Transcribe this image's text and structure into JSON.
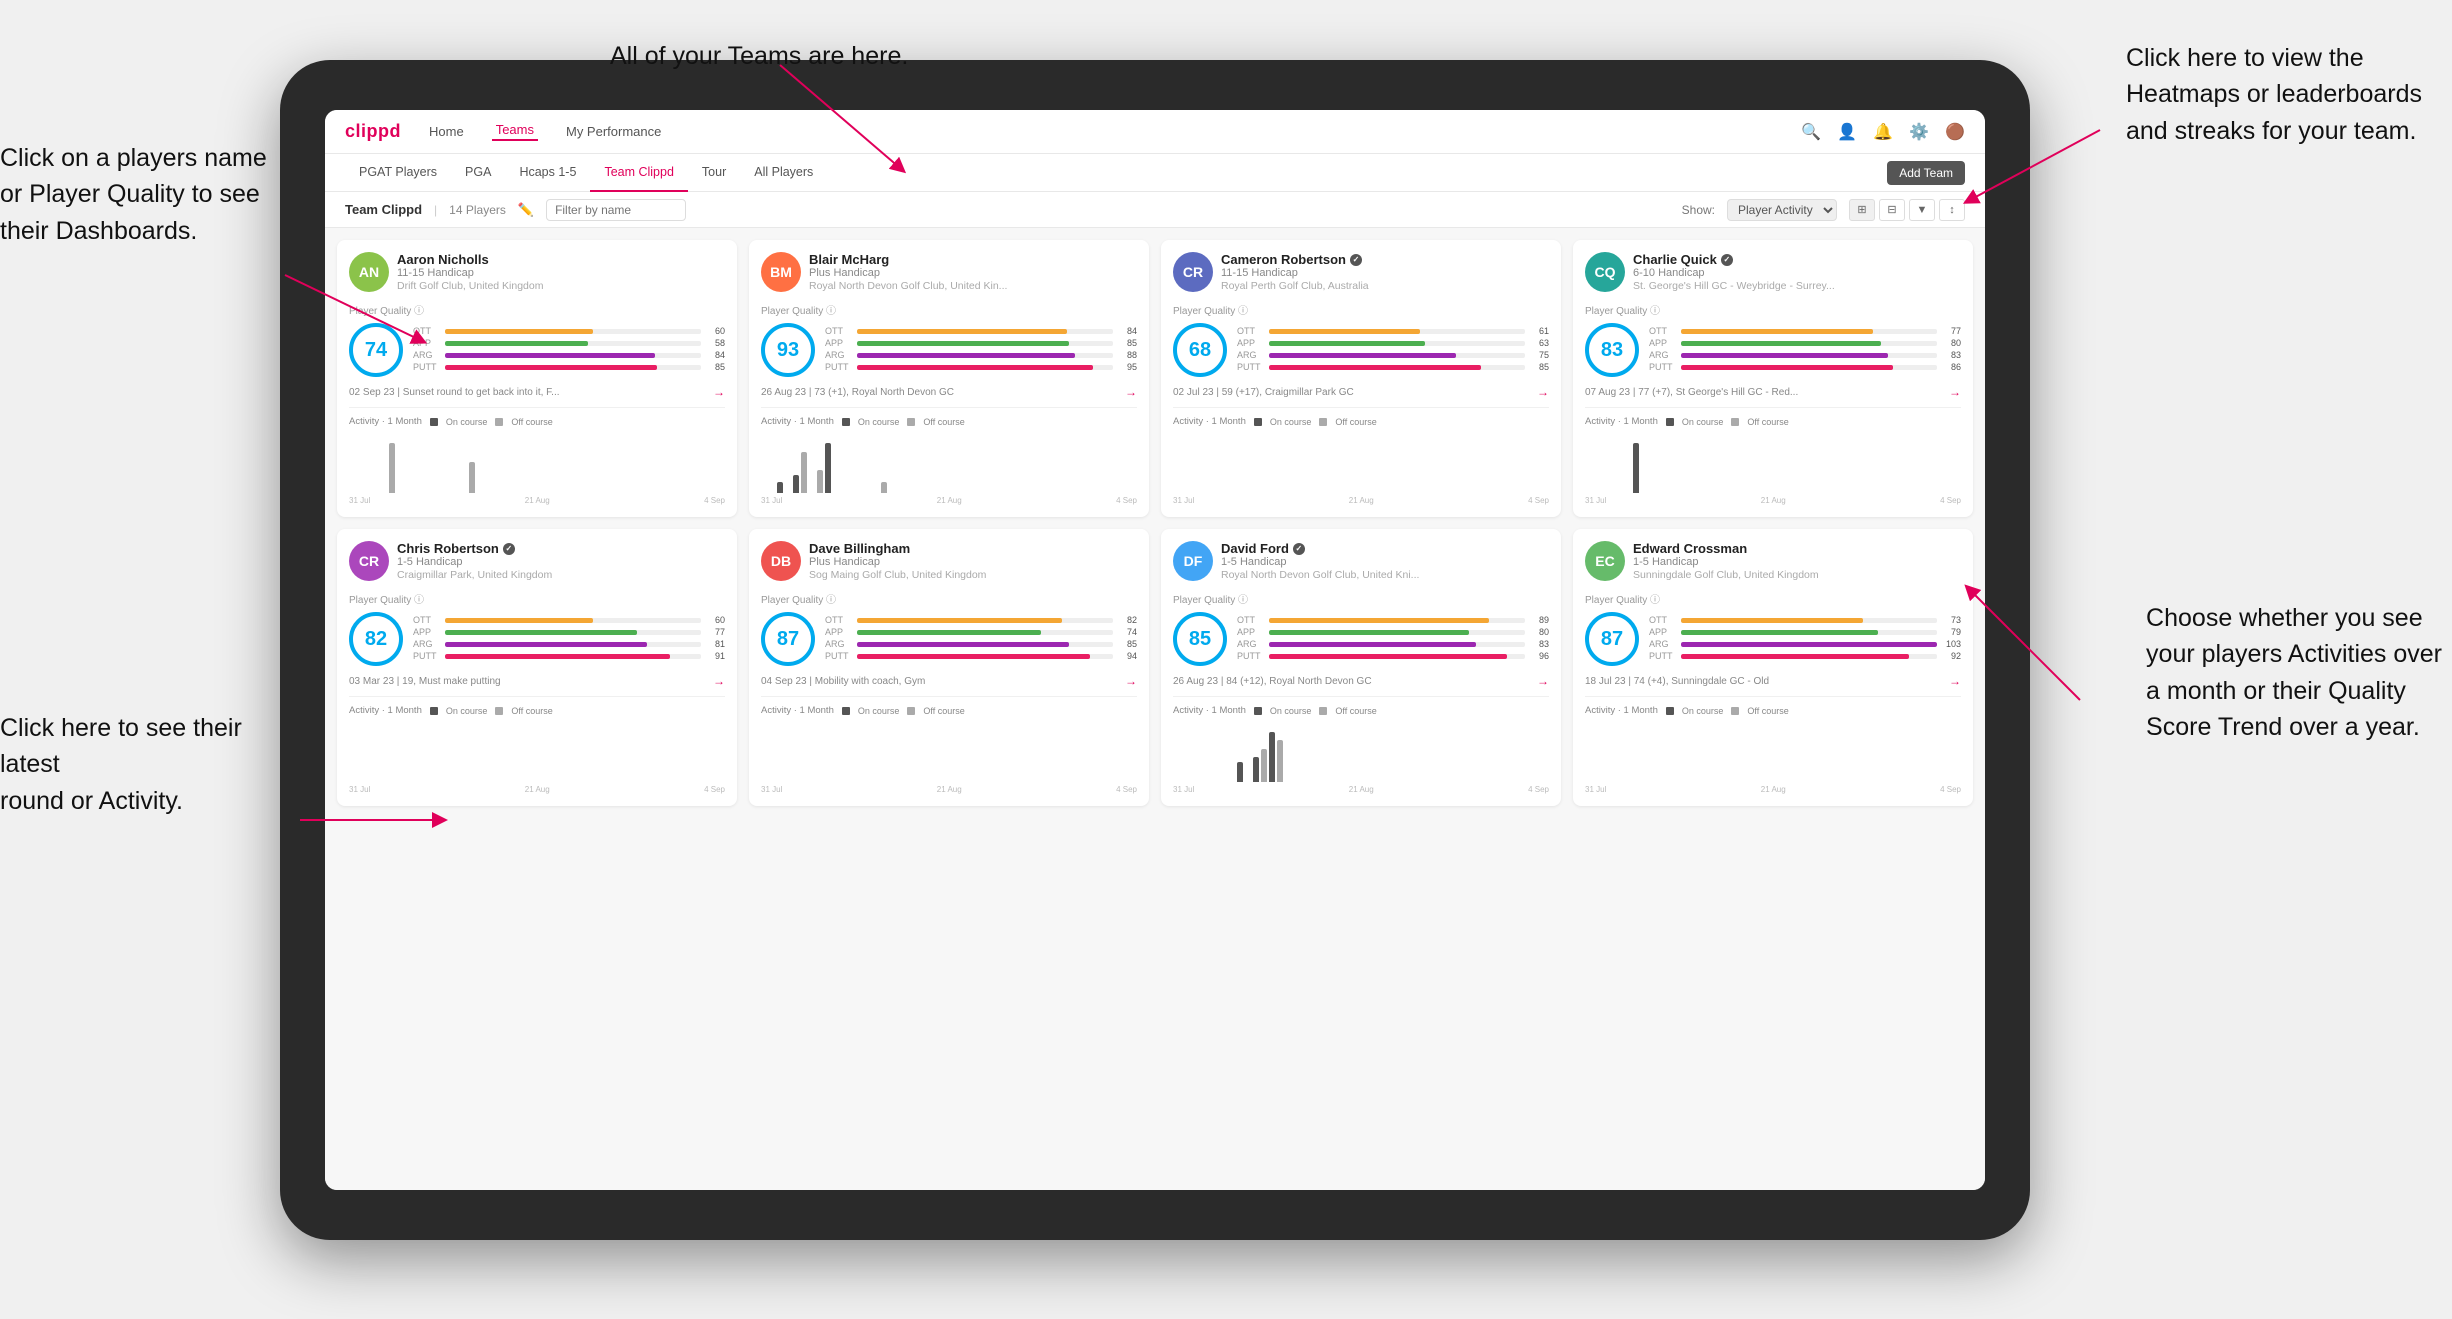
{
  "annotations": {
    "top_teams": "All of your Teams are here.",
    "top_right_heatmaps": "Click here to view the\nHeatmaps or leaderboards\nand streaks for your team.",
    "left_names": "Click on a players name\nor Player Quality to see\ntheir Dashboards.",
    "left_rounds": "Click here to see their latest\nround or Activity.",
    "right_activities": "Choose whether you see\nyour players Activities over\na month or their Quality\nScore Trend over a year."
  },
  "navbar": {
    "logo": "clippd",
    "links": [
      "Home",
      "Teams",
      "My Performance"
    ],
    "active": "Teams"
  },
  "subtabs": {
    "tabs": [
      "PGAT Players",
      "PGA",
      "Hcaps 1-5",
      "Team Clippd",
      "Tour",
      "All Players"
    ],
    "active": "Team Clippd",
    "add_button": "Add Team"
  },
  "team_header": {
    "title": "Team Clippd",
    "separator": "|",
    "player_count": "14 Players",
    "filter_placeholder": "Filter by name",
    "show_label": "Show:",
    "show_option": "Player Activity",
    "view_modes": [
      "grid4",
      "grid3",
      "filter",
      "sort"
    ]
  },
  "players": [
    {
      "name": "Aaron Nicholls",
      "handicap": "11-15 Handicap",
      "club": "Drift Golf Club, United Kingdom",
      "score": 74,
      "score_color": "#00aaee",
      "avatar_color": "#8bc34a",
      "avatar_initials": "AN",
      "stats": [
        {
          "label": "OTT",
          "value": 60,
          "color": "#f4a634"
        },
        {
          "label": "APP",
          "value": 58,
          "color": "#4caf50"
        },
        {
          "label": "ARG",
          "value": 84,
          "color": "#9c27b0"
        },
        {
          "label": "PUTT",
          "value": 85,
          "color": "#e91e63"
        }
      ],
      "latest_round": "02 Sep 23 | Sunset round to get back into it, F...",
      "chart_bars": [
        0,
        0,
        0,
        0,
        0,
        8,
        0,
        0,
        0,
        0,
        0,
        0,
        0,
        0,
        0,
        5,
        0
      ],
      "chart_labels": [
        "31 Jul",
        "21 Aug",
        "4 Sep"
      ],
      "verified": false
    },
    {
      "name": "Blair McHarg",
      "handicap": "Plus Handicap",
      "club": "Royal North Devon Golf Club, United Kin...",
      "score": 93,
      "score_color": "#00aaee",
      "avatar_color": "#ff7043",
      "avatar_initials": "BM",
      "stats": [
        {
          "label": "OTT",
          "value": 84,
          "color": "#f4a634"
        },
        {
          "label": "APP",
          "value": 85,
          "color": "#4caf50"
        },
        {
          "label": "ARG",
          "value": 88,
          "color": "#9c27b0"
        },
        {
          "label": "PUTT",
          "value": 95,
          "color": "#e91e63"
        }
      ],
      "latest_round": "26 Aug 23 | 73 (+1), Royal North Devon GC",
      "chart_bars": [
        0,
        0,
        5,
        0,
        8,
        18,
        0,
        10,
        22,
        0,
        0,
        0,
        0,
        0,
        0,
        5,
        0
      ],
      "chart_labels": [
        "31 Jul",
        "21 Aug",
        "4 Sep"
      ],
      "verified": false
    },
    {
      "name": "Cameron Robertson",
      "handicap": "11-15 Handicap",
      "club": "Royal Perth Golf Club, Australia",
      "score": 68,
      "score_color": "#00aaee",
      "avatar_color": "#5c6bc0",
      "avatar_initials": "CR",
      "stats": [
        {
          "label": "OTT",
          "value": 61,
          "color": "#f4a634"
        },
        {
          "label": "APP",
          "value": 63,
          "color": "#4caf50"
        },
        {
          "label": "ARG",
          "value": 75,
          "color": "#9c27b0"
        },
        {
          "label": "PUTT",
          "value": 85,
          "color": "#e91e63"
        }
      ],
      "latest_round": "02 Jul 23 | 59 (+17), Craigmillar Park GC",
      "chart_bars": [
        0,
        0,
        0,
        0,
        0,
        0,
        0,
        0,
        0,
        0,
        0,
        0,
        0,
        0,
        0,
        0,
        0
      ],
      "chart_labels": [
        "31 Jul",
        "21 Aug",
        "4 Sep"
      ],
      "verified": true
    },
    {
      "name": "Charlie Quick",
      "handicap": "6-10 Handicap",
      "club": "St. George's Hill GC - Weybridge - Surrey...",
      "score": 83,
      "score_color": "#00aaee",
      "avatar_color": "#26a69a",
      "avatar_initials": "CQ",
      "stats": [
        {
          "label": "OTT",
          "value": 77,
          "color": "#f4a634"
        },
        {
          "label": "APP",
          "value": 80,
          "color": "#4caf50"
        },
        {
          "label": "ARG",
          "value": 83,
          "color": "#9c27b0"
        },
        {
          "label": "PUTT",
          "value": 86,
          "color": "#e91e63"
        }
      ],
      "latest_round": "07 Aug 23 | 77 (+7), St George's Hill GC - Red...",
      "chart_bars": [
        0,
        0,
        0,
        0,
        0,
        0,
        10,
        0,
        0,
        0,
        0,
        0,
        0,
        0,
        0,
        0,
        0
      ],
      "chart_labels": [
        "31 Jul",
        "21 Aug",
        "4 Sep"
      ],
      "verified": true
    },
    {
      "name": "Chris Robertson",
      "handicap": "1-5 Handicap",
      "club": "Craigmillar Park, United Kingdom",
      "score": 82,
      "score_color": "#00aaee",
      "avatar_color": "#ab47bc",
      "avatar_initials": "CR",
      "stats": [
        {
          "label": "OTT",
          "value": 60,
          "color": "#f4a634"
        },
        {
          "label": "APP",
          "value": 77,
          "color": "#4caf50"
        },
        {
          "label": "ARG",
          "value": 81,
          "color": "#9c27b0"
        },
        {
          "label": "PUTT",
          "value": 91,
          "color": "#e91e63"
        }
      ],
      "latest_round": "03 Mar 23 | 19, Must make putting",
      "chart_bars": [
        0,
        0,
        0,
        0,
        0,
        0,
        0,
        0,
        0,
        0,
        0,
        0,
        0,
        0,
        0,
        0,
        0
      ],
      "chart_labels": [
        "31 Jul",
        "21 Aug",
        "4 Sep"
      ],
      "verified": true
    },
    {
      "name": "Dave Billingham",
      "handicap": "Plus Handicap",
      "club": "Sog Maing Golf Club, United Kingdom",
      "score": 87,
      "score_color": "#00aaee",
      "avatar_color": "#ef5350",
      "avatar_initials": "DB",
      "stats": [
        {
          "label": "OTT",
          "value": 82,
          "color": "#f4a634"
        },
        {
          "label": "APP",
          "value": 74,
          "color": "#4caf50"
        },
        {
          "label": "ARG",
          "value": 85,
          "color": "#9c27b0"
        },
        {
          "label": "PUTT",
          "value": 94,
          "color": "#e91e63"
        }
      ],
      "latest_round": "04 Sep 23 | Mobility with coach, Gym",
      "chart_bars": [
        0,
        0,
        0,
        0,
        0,
        0,
        0,
        0,
        0,
        0,
        0,
        0,
        0,
        0,
        0,
        0,
        0
      ],
      "chart_labels": [
        "31 Jul",
        "21 Aug",
        "4 Sep"
      ],
      "verified": false
    },
    {
      "name": "David Ford",
      "handicap": "1-5 Handicap",
      "club": "Royal North Devon Golf Club, United Kni...",
      "score": 85,
      "score_color": "#00aaee",
      "avatar_color": "#42a5f5",
      "avatar_initials": "DF",
      "stats": [
        {
          "label": "OTT",
          "value": 89,
          "color": "#f4a634"
        },
        {
          "label": "APP",
          "value": 80,
          "color": "#4caf50"
        },
        {
          "label": "ARG",
          "value": 83,
          "color": "#9c27b0"
        },
        {
          "label": "PUTT",
          "value": 96,
          "color": "#e91e63"
        }
      ],
      "latest_round": "26 Aug 23 | 84 (+12), Royal North Devon GC",
      "chart_bars": [
        0,
        0,
        0,
        0,
        0,
        0,
        0,
        0,
        12,
        0,
        15,
        20,
        30,
        25,
        0,
        0,
        0
      ],
      "chart_labels": [
        "31 Jul",
        "21 Aug",
        "4 Sep"
      ],
      "verified": true
    },
    {
      "name": "Edward Crossman",
      "handicap": "1-5 Handicap",
      "club": "Sunningdale Golf Club, United Kingdom",
      "score": 87,
      "score_color": "#00aaee",
      "avatar_color": "#66bb6a",
      "avatar_initials": "EC",
      "stats": [
        {
          "label": "OTT",
          "value": 73,
          "color": "#f4a634"
        },
        {
          "label": "APP",
          "value": 79,
          "color": "#4caf50"
        },
        {
          "label": "ARG",
          "value": 103,
          "color": "#9c27b0"
        },
        {
          "label": "PUTT",
          "value": 92,
          "color": "#e91e63"
        }
      ],
      "latest_round": "18 Jul 23 | 74 (+4), Sunningdale GC - Old",
      "chart_bars": [
        0,
        0,
        0,
        0,
        0,
        0,
        0,
        0,
        0,
        0,
        0,
        0,
        0,
        0,
        0,
        0,
        0
      ],
      "chart_labels": [
        "31 Jul",
        "21 Aug",
        "4 Sep"
      ],
      "verified": false
    }
  ],
  "activity_legend": {
    "label": "Activity · 1 Month",
    "on_course_label": "On course",
    "off_course_label": "Off course",
    "on_course_color": "#555",
    "off_course_color": "#aaa"
  }
}
